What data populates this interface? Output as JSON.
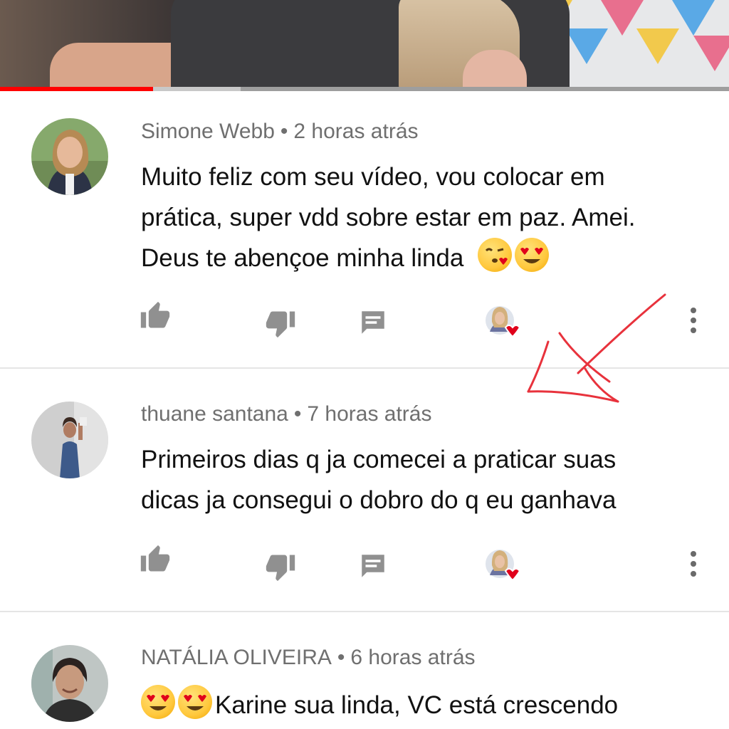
{
  "video": {
    "progress_played": 0.21,
    "progress_buffered": 0.33,
    "accent_color": "#ff0000"
  },
  "comments": [
    {
      "author": "Simone Webb",
      "separator": "•",
      "time": "2 horas atrás",
      "text_lines": [
        "Muito feliz com seu vídeo, vou colocar em",
        "prática, super vdd sobre estar em paz. Amei.",
        "Deus te abençoe minha linda"
      ],
      "emojis": [
        "face-blowing-kiss-emoji",
        "heart-eyes-emoji"
      ],
      "hearted_by_creator": true
    },
    {
      "author": "thuane santana",
      "separator": "•",
      "time": "7 horas atrás",
      "text_lines": [
        "Primeiros dias q ja comecei a praticar suas",
        "dicas ja consegui o dobro do q eu ganhava"
      ],
      "hearted_by_creator": true
    },
    {
      "author": "NATÁLIA OLIVEIRA",
      "separator": "•",
      "time": "6 horas atrás",
      "text_lines": [
        "Karine sua linda, VC está crescendo"
      ],
      "emojis": [
        "heart-eyes-emoji",
        "heart-eyes-emoji"
      ]
    }
  ],
  "icons": {
    "like": "thumbs-up-icon",
    "dislike": "thumbs-down-icon",
    "reply": "reply-comment-icon",
    "creator_heart": "creator-heart-icon",
    "more": "more-vertical-icon"
  },
  "colors": {
    "meta_text": "#6f6f6f",
    "body_text": "#111111",
    "icon": "#909090",
    "heart": "#e0001b",
    "annotation": "#e8323c"
  }
}
